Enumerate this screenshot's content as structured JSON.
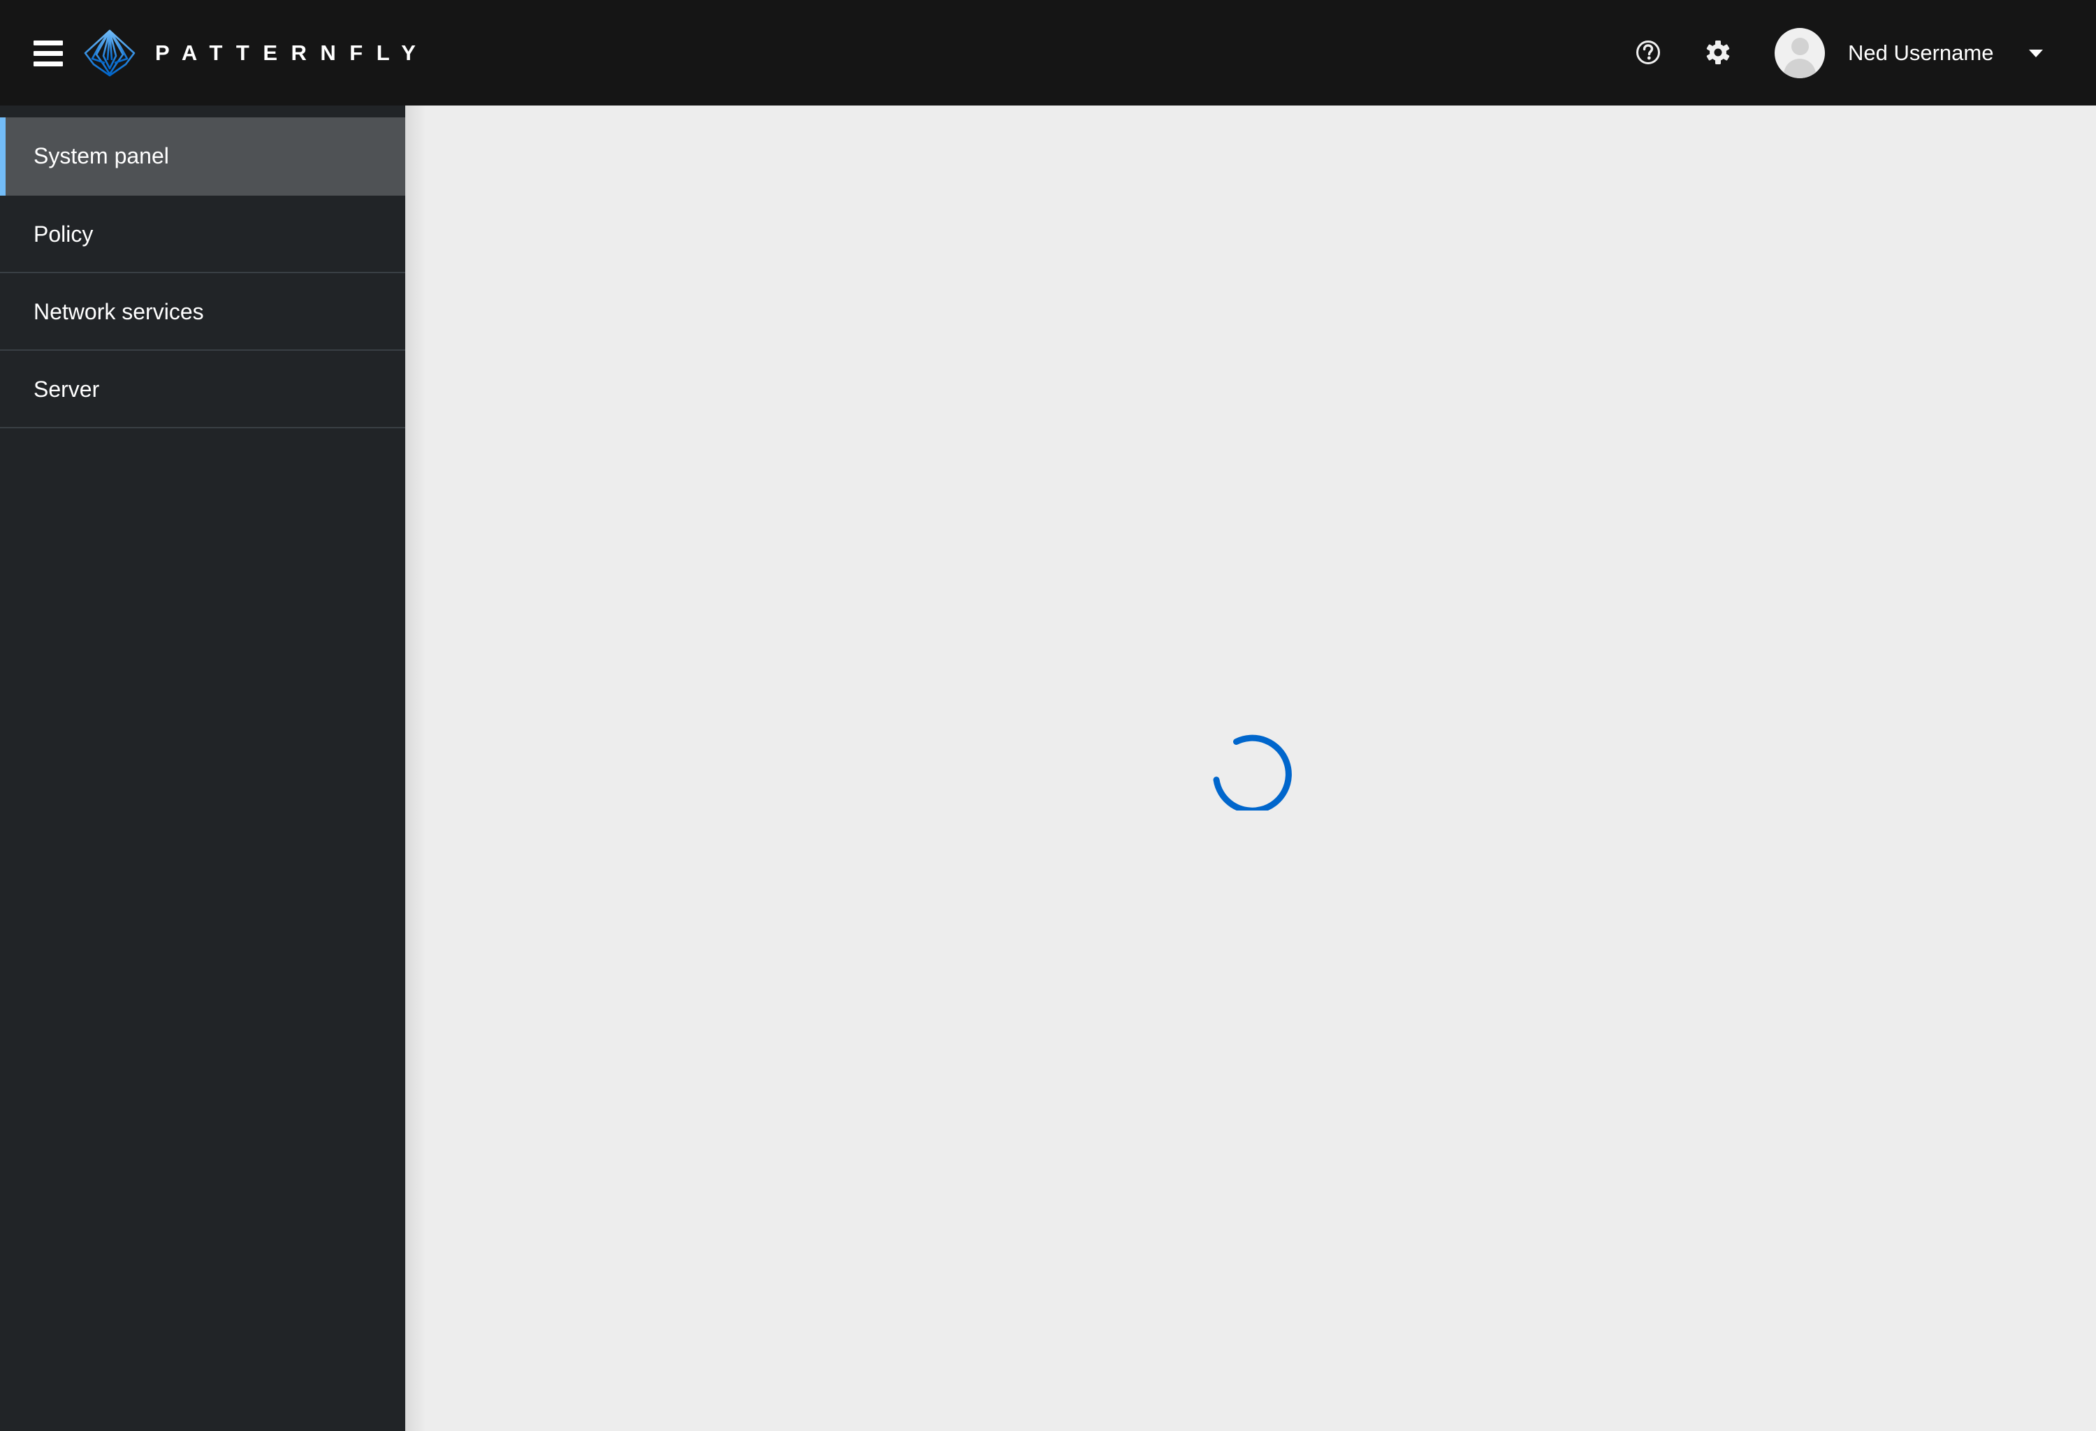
{
  "header": {
    "menu_toggle": "hamburger-menu-icon",
    "brand": {
      "logo_icon": "patternfly-logo-icon",
      "name": "PATTERNFLY",
      "logo_color": "#2b9af3"
    },
    "tools": [
      {
        "icon": "help-icon",
        "label": "Help"
      },
      {
        "icon": "gear-icon",
        "label": "Settings"
      }
    ],
    "user": {
      "avatar_icon": "user-avatar-icon",
      "name": "Ned Username",
      "dropdown_icon": "caret-down-icon"
    }
  },
  "sidebar": {
    "items": [
      {
        "label": "System panel",
        "active": true
      },
      {
        "label": "Policy",
        "active": false
      },
      {
        "label": "Network services",
        "active": false
      },
      {
        "label": "Server",
        "active": false
      }
    ],
    "active_accent_color": "#73bcf7"
  },
  "main": {
    "state": "loading",
    "spinner_icon": "loading-spinner-icon",
    "spinner_color": "#0066cc"
  }
}
